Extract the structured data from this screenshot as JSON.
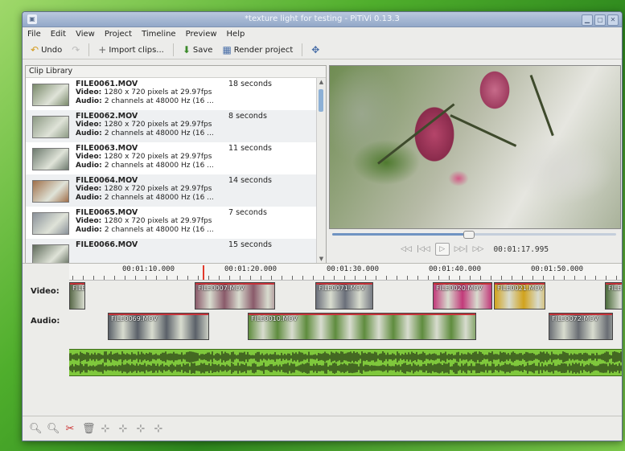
{
  "window": {
    "title": "*texture light for testing - PiTiVi 0.13.3"
  },
  "menu": [
    "File",
    "Edit",
    "View",
    "Project",
    "Timeline",
    "Preview",
    "Help"
  ],
  "toolbar": {
    "undo": "Undo",
    "import": "Import clips...",
    "save": "Save",
    "render": "Render project"
  },
  "library": {
    "title": "Clip Library",
    "clips": [
      {
        "name": "FILE0061.MOV",
        "video": "1280 x 720 pixels at 29.97fps",
        "audio": "2 channels at 48000 Hz (16 ...",
        "duration": "18 seconds",
        "thumb": "#7a8a6b"
      },
      {
        "name": "FILE0062.MOV",
        "video": "1280 x 720 pixels at 29.97fps",
        "audio": "2 channels at 48000 Hz (16 ...",
        "duration": "8 seconds",
        "thumb": "#8c9a84"
      },
      {
        "name": "FILE0063.MOV",
        "video": "1280 x 720 pixels at 29.97fps",
        "audio": "2 channels at 48000 Hz (16 ...",
        "duration": "11 seconds",
        "thumb": "#6d7a6e"
      },
      {
        "name": "FILE0064.MOV",
        "video": "1280 x 720 pixels at 29.97fps",
        "audio": "2 channels at 48000 Hz (16 ...",
        "duration": "14 seconds",
        "thumb": "#a0704a"
      },
      {
        "name": "FILE0065.MOV",
        "video": "1280 x 720 pixels at 29.97fps",
        "audio": "2 channels at 48000 Hz (16 ...",
        "duration": "7 seconds",
        "thumb": "#8a9199"
      },
      {
        "name": "FILE0066.MOV",
        "video": "",
        "audio": "",
        "duration": "15 seconds",
        "thumb": "#5e6a5a"
      }
    ]
  },
  "viewer": {
    "position": "00:01:17.995",
    "seek_fraction": 0.48
  },
  "timeline": {
    "ruler": [
      "00:01:10.000",
      "00:01:20.000",
      "00:01:30.000",
      "00:01:40.000",
      "00:01:50.000"
    ],
    "video_label": "Video:",
    "audio_label": "Audio:",
    "video_clips": [
      {
        "name": "FILE",
        "color": "#5a6a4a"
      },
      {
        "name": "FILE0007.MOV",
        "color": "#8a5a6a"
      },
      {
        "name": "FILE0071.MOV",
        "color": "#6a6f7a"
      },
      {
        "name": "FILE0020.MOV",
        "color": "#c23a7a"
      },
      {
        "name": "FILE0021.MOV",
        "color": "#d1a21c"
      },
      {
        "name": "FILE",
        "color": "#4a6a3a"
      }
    ],
    "audio_clips": [
      {
        "name": "FILE0069.MOV",
        "color": "#5b6169"
      },
      {
        "name": "FILE0010.MOV",
        "color": "#5f8c3e"
      },
      {
        "name": "FILE0072.MOV",
        "color": "#6a6e74"
      }
    ]
  },
  "labels": {
    "video_prefix": "Video: ",
    "audio_prefix": "Audio: "
  }
}
